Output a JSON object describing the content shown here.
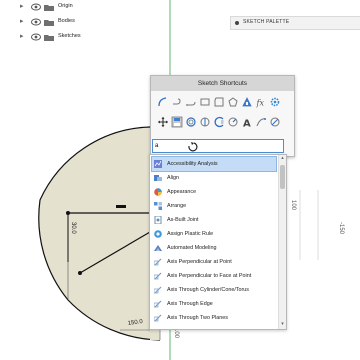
{
  "browser": {
    "items": [
      {
        "label": "Origin",
        "icon": "folder-icon"
      },
      {
        "label": "Bodies",
        "icon": "folder-icon"
      },
      {
        "label": "Sketches",
        "icon": "folder-icon"
      }
    ]
  },
  "palette": {
    "label": "SKETCH PALETTE"
  },
  "shortcuts": {
    "title": "Sketch Shortcuts",
    "row1": [
      "line-tool-icon",
      "arc-tool-icon",
      "spline-tool-icon",
      "rectangle-tool-icon",
      "polygon-tool-icon",
      "circle-tool-icon",
      "triangle-tool-icon",
      "fx-parameters-icon",
      "gear-tool-icon"
    ],
    "row2": [
      "move-tool-icon",
      "save-sketch-icon",
      "offset-tool-icon",
      "mirror-tool-icon",
      "project-tool-icon",
      "fillet-tool-icon",
      "text-tool-icon",
      "fit-point-spline-icon",
      "constraint-tool-icon"
    ],
    "search_value": "a"
  },
  "dropdown": {
    "items": [
      {
        "label": "Accessibility Analysis",
        "icon": "analysis-icon",
        "color": "#6a7fd6"
      },
      {
        "label": "Align",
        "icon": "align-icon",
        "color": "#4a7fc1"
      },
      {
        "label": "Appearance",
        "icon": "appearance-icon",
        "color": "#e05a4a"
      },
      {
        "label": "Arrange",
        "icon": "arrange-icon",
        "color": "#5a8fd0"
      },
      {
        "label": "As-Built Joint",
        "icon": "joint-icon",
        "color": "#6f8fb0"
      },
      {
        "label": "Assign Plastic Rule",
        "icon": "plastic-rule-icon",
        "color": "#3a9ad9"
      },
      {
        "label": "Automated Modeling",
        "icon": "modeling-icon",
        "color": "#5a7fc0"
      },
      {
        "label": "Axis Perpendicular at Point",
        "icon": "axis-icon",
        "color": "#7a9cc8"
      },
      {
        "label": "Axis Perpendicular to Face at Point",
        "icon": "axis-icon",
        "color": "#7a9cc8"
      },
      {
        "label": "Axis Through Cylinder/Cone/Torus",
        "icon": "axis-icon",
        "color": "#7a9cc8"
      },
      {
        "label": "Axis Through Edge",
        "icon": "axis-icon",
        "color": "#7a9cc8"
      },
      {
        "label": "Axis Through Two Planes",
        "icon": "axis-icon",
        "color": "#7a9cc8"
      }
    ]
  },
  "dimensions": {
    "left_vertical": "30.0",
    "bottom": "150.0",
    "right_ruler": "100",
    "far_right_ruler": "-150",
    "bottom_ruler": "100"
  },
  "colors": {
    "sketch_fill": "#e4e1cf",
    "axis_green": "#3fa34d",
    "accent_blue": "#4b8dd6",
    "selected_row": "#c4dcf5"
  }
}
